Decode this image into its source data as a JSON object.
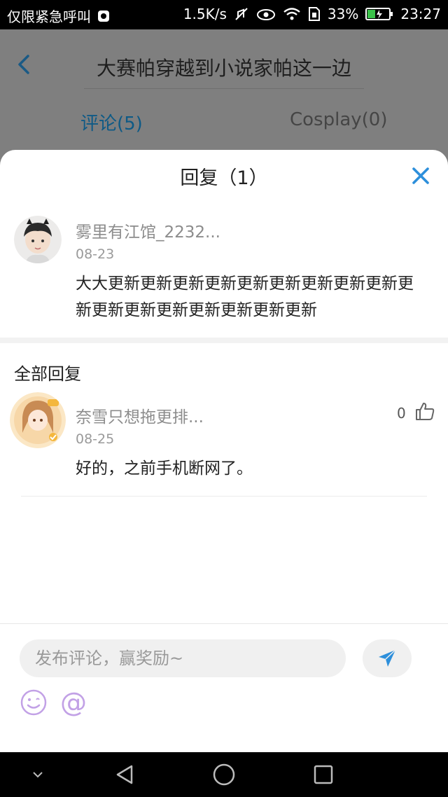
{
  "status_bar": {
    "carrier": "仅限紧急呼叫",
    "speed": "1.5K/s",
    "battery": "33%",
    "time": "23:27"
  },
  "background_page": {
    "title": "大赛帕穿越到小说家帕这一边",
    "tabs": [
      {
        "label": "评论(5)",
        "active": true
      },
      {
        "label": "Cosplay(0)",
        "active": false
      }
    ]
  },
  "sheet": {
    "title": "回复（1）",
    "original_comment": {
      "username": "雾里有江馆_2232...",
      "date": "08-23",
      "text": "大大更新更新更新更新更新更新更新更新更新更新更新更新更新更新更新更新更新"
    },
    "section_title": "全部回复",
    "replies": [
      {
        "username": "奈雪只想拖更排...",
        "date": "08-25",
        "text": "好的，之前手机断网了。",
        "likes": "0"
      }
    ]
  },
  "composer": {
    "placeholder": "发布评论，赢奖励~",
    "at_symbol": "@"
  },
  "colors": {
    "accent": "#2d8fdb",
    "emoji_purple": "#c2a1e6"
  }
}
